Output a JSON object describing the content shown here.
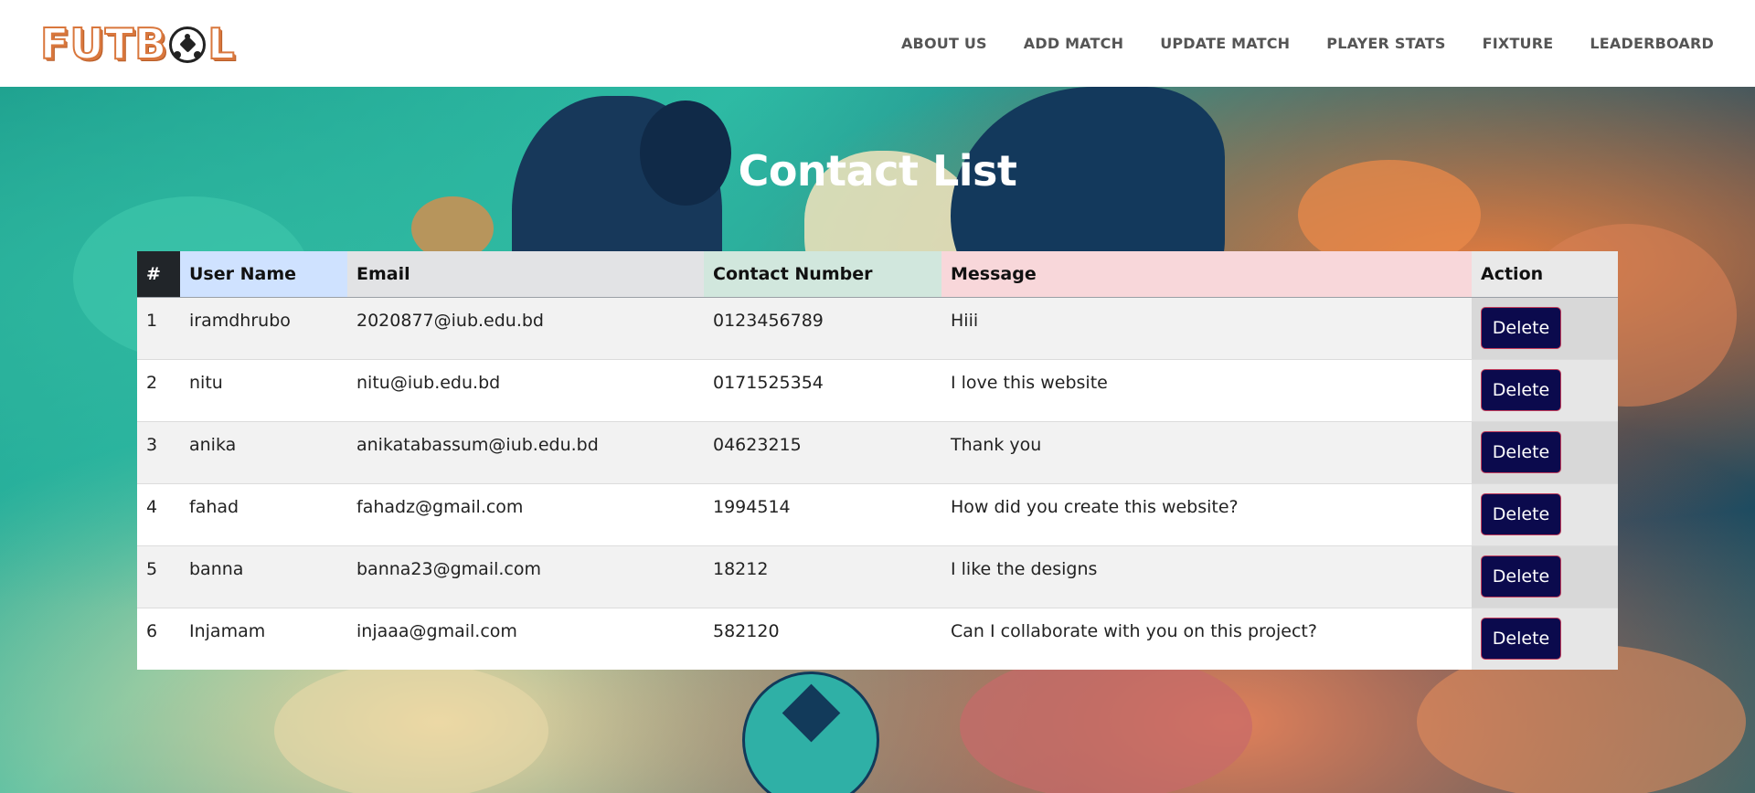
{
  "brand": {
    "logo_text_left": "FUTB",
    "logo_text_right": "L"
  },
  "nav": {
    "items": [
      {
        "label": "ABOUT US"
      },
      {
        "label": "ADD MATCH"
      },
      {
        "label": "UPDATE MATCH"
      },
      {
        "label": "PLAYER STATS"
      },
      {
        "label": "FIXTURE"
      },
      {
        "label": "LEADERBOARD"
      }
    ]
  },
  "page": {
    "title": "Contact List"
  },
  "table": {
    "headers": {
      "num": "#",
      "user": "User Name",
      "email": "Email",
      "contact": "Contact Number",
      "message": "Message",
      "action": "Action"
    },
    "delete_label": "Delete",
    "rows": [
      {
        "num": "1",
        "user": "iramdhrubo",
        "email": "2020877@iub.edu.bd",
        "contact": "0123456789",
        "message": "Hiii"
      },
      {
        "num": "2",
        "user": "nitu",
        "email": "nitu@iub.edu.bd",
        "contact": "0171525354",
        "message": "I love this website"
      },
      {
        "num": "3",
        "user": "anika",
        "email": "anikatabassum@iub.edu.bd",
        "contact": "04623215",
        "message": "Thank you"
      },
      {
        "num": "4",
        "user": "fahad",
        "email": "fahadz@gmail.com",
        "contact": "1994514",
        "message": "How did you create this website?"
      },
      {
        "num": "5",
        "user": "banna",
        "email": "banna23@gmail.com",
        "contact": "18212",
        "message": "I like the designs"
      },
      {
        "num": "6",
        "user": "Injamam",
        "email": "injaaa@gmail.com",
        "contact": "582120",
        "message": "Can I collaborate with you on this project?"
      }
    ]
  },
  "colors": {
    "header_num_bg": "#212529",
    "header_user_bg": "#cfe2ff",
    "header_email_bg": "#e2e3e5",
    "header_contact_bg": "#d1e7dd",
    "header_message_bg": "#f8d7da",
    "delete_button_bg": "#0b0a4d",
    "logo_orange": "#d9773d"
  }
}
